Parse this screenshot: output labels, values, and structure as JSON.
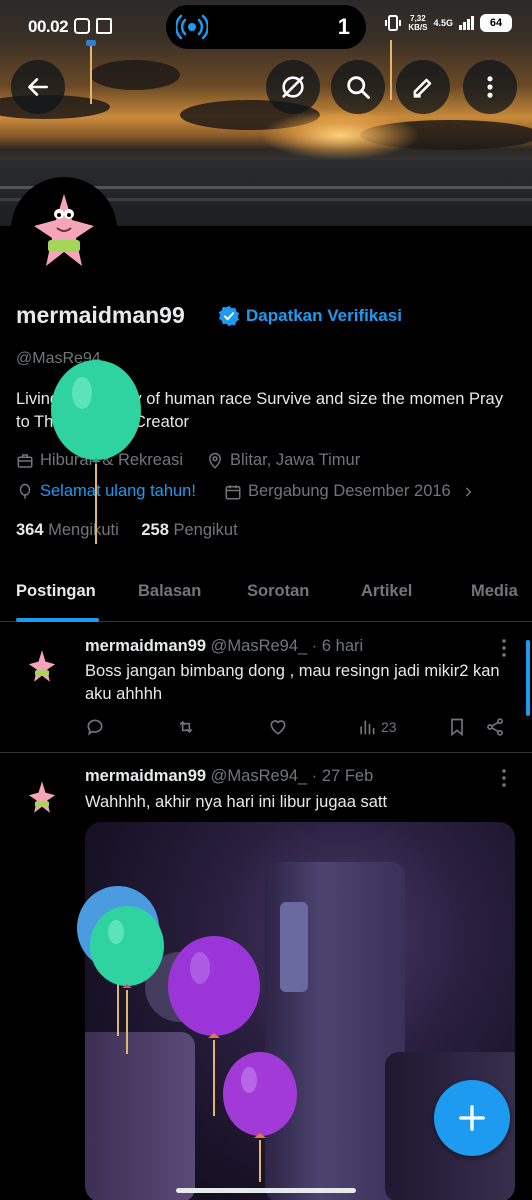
{
  "status_bar": {
    "time": "00.02",
    "live_count": "1",
    "speed": "7,32",
    "speed_unit": "KB/S",
    "network": "4.5G",
    "battery": "64"
  },
  "profile": {
    "name": "mermaidman99",
    "get_verified_label": "Dapatkan Verifikasi",
    "handle": "@MasRe94_",
    "bio": "Living in diversity of human race Survive and size the momen Pray to The Almighty Creator",
    "category": "Hiburan & Rekreasi",
    "location": "Blitar, Jawa Timur",
    "birthday": "Selamat ulang tahun!",
    "joined": "Bergabung Desember 2016",
    "following_count": "364",
    "following_label": "Mengikuti",
    "followers_count": "258",
    "followers_label": "Pengikut"
  },
  "tabs": [
    {
      "label": "Postingan",
      "active": true
    },
    {
      "label": "Balasan",
      "active": false
    },
    {
      "label": "Sorotan",
      "active": false
    },
    {
      "label": "Artikel",
      "active": false
    },
    {
      "label": "Media",
      "active": false
    }
  ],
  "posts": [
    {
      "name": "mermaidman99",
      "handle": "@MasRe94_",
      "time": "· 6 hari",
      "text": "Boss jangan bimbang dong , mau resingn jadi mikir2 kan aku ahhhh",
      "views": "23"
    },
    {
      "name": "mermaidman99",
      "handle": "@MasRe94_",
      "time": "· 27 Feb",
      "text": "Wahhhh, akhir nya hari ini libur jugaa satt"
    }
  ],
  "colors": {
    "accent": "#1d9bf0",
    "background": "#000000",
    "text_primary": "#e7e9ea",
    "text_secondary": "#71767b"
  },
  "icons": {
    "back": "arrow-left-icon",
    "hide": "eye-slash-circle-icon",
    "search": "search-icon",
    "edit": "pencil-icon",
    "more": "more-vertical-icon",
    "compose": "plus-icon"
  }
}
